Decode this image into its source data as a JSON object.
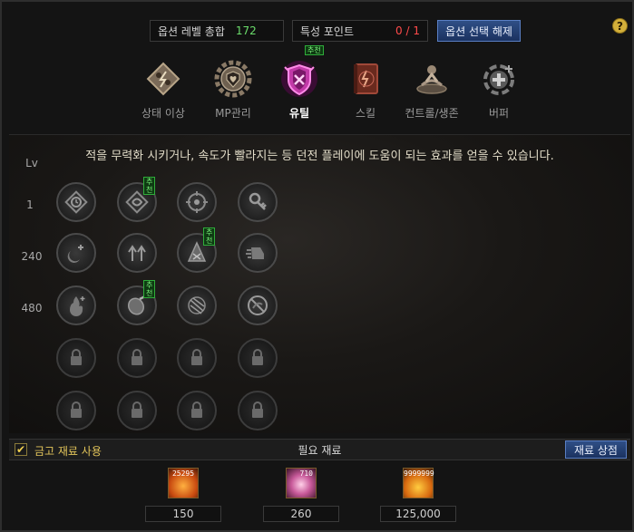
{
  "header": {
    "option_level_label": "옵션 레벨 총합",
    "option_level_value": "172",
    "trait_points_label": "특성 포인트",
    "trait_points_value": "0 / 1",
    "release_button": "옵션 선택 해제",
    "help": "?"
  },
  "categories": [
    {
      "label": "상태 이상",
      "icon": "status-effect-icon"
    },
    {
      "label": "MP관리",
      "icon": "mp-gear-shield-icon"
    },
    {
      "label": "유틸",
      "icon": "utility-shield-icon",
      "active": true,
      "tag": "추천"
    },
    {
      "label": "스킬",
      "icon": "skill-book-icon"
    },
    {
      "label": "컨트롤/생존",
      "icon": "control-survival-icon"
    },
    {
      "label": "버퍼",
      "icon": "buffer-plus-icon"
    }
  ],
  "description": "적을 무력화 시키거나, 속도가 빨라지는 등 던전 플레이에 도움이 되는 효과를 얻을 수 있습니다.",
  "levels": {
    "header": "Lv",
    "rows": [
      "1",
      "240",
      "480"
    ]
  },
  "recommend_tag": "추천",
  "bottom": {
    "checkbox_label": "금고 재료 사용",
    "materials_title": "필요 재료",
    "shop_button": "재료 상점"
  },
  "materials": [
    {
      "count": "25295",
      "value": "150",
      "icon": "orange-crystal-icon"
    },
    {
      "count": "710",
      "value": "260",
      "icon": "pink-essence-icon"
    },
    {
      "count": "9999999",
      "value": "125,000",
      "icon": "gold-coins-icon"
    }
  ],
  "colors": {
    "accent_blue": "#2f4f86",
    "green_value": "#6bdc6b",
    "red_value": "#ff4a4a",
    "active_category": "#c23aa8",
    "recommend_green": "#2fae3a"
  }
}
